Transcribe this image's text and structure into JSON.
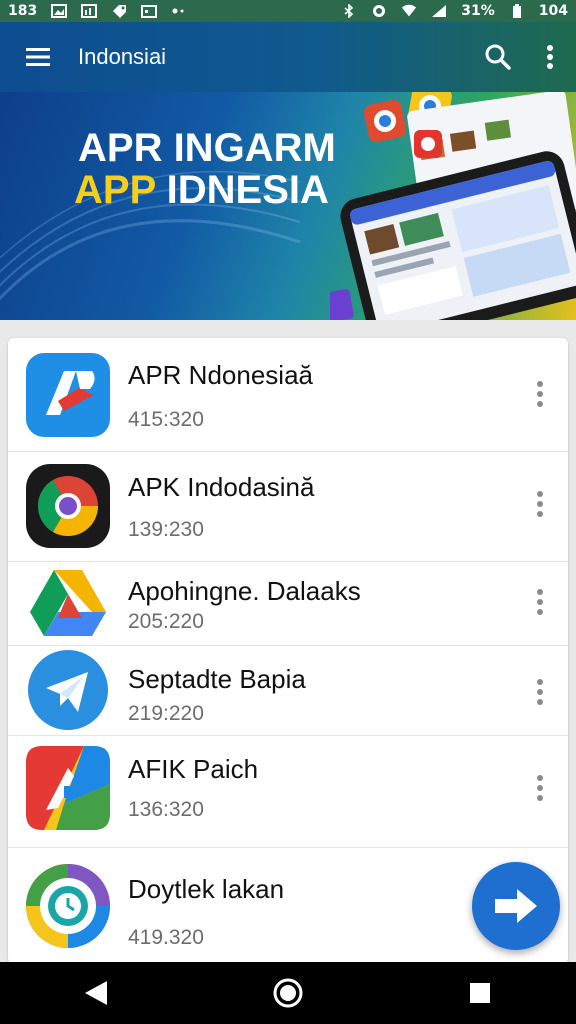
{
  "status_bar": {
    "time": "183",
    "battery_text": "31%",
    "battery_level": "104"
  },
  "app_bar": {
    "title": "Indonsiai",
    "menu_icon": "hamburger-menu-icon",
    "search_icon": "search-icon",
    "more_icon": "more-vertical-icon"
  },
  "hero": {
    "line1": "APR INGARM",
    "line2_highlight": "APP",
    "line2_rest": "IDNESIA"
  },
  "apps": [
    {
      "name": "APR Ndonesiaă",
      "meta": "415:320",
      "icon": "apr-app-icon"
    },
    {
      "name": "APK Indodasină",
      "meta": "139:230",
      "icon": "chrome-like-icon"
    },
    {
      "name": "Apohingne. Dalaaks",
      "meta": "205:220",
      "icon": "drive-like-icon"
    },
    {
      "name": "Septadte Bapia",
      "meta": "219:220",
      "icon": "telegram-like-icon"
    },
    {
      "name": "AFIK Paich",
      "meta": "136:320",
      "icon": "afik-app-icon"
    },
    {
      "name": "Doytlek lakan",
      "meta": "419.320",
      "icon": "circle-app-icon"
    }
  ],
  "fab": {
    "icon": "arrow-right-icon"
  },
  "nav": {
    "back_icon": "back-triangle-icon",
    "home_icon": "home-circle-icon",
    "recents_icon": "recents-square-icon"
  },
  "colors": {
    "app_bar": "#0d4d91",
    "accent_yellow": "#f5cf1c",
    "fab": "#1f6fd1"
  }
}
